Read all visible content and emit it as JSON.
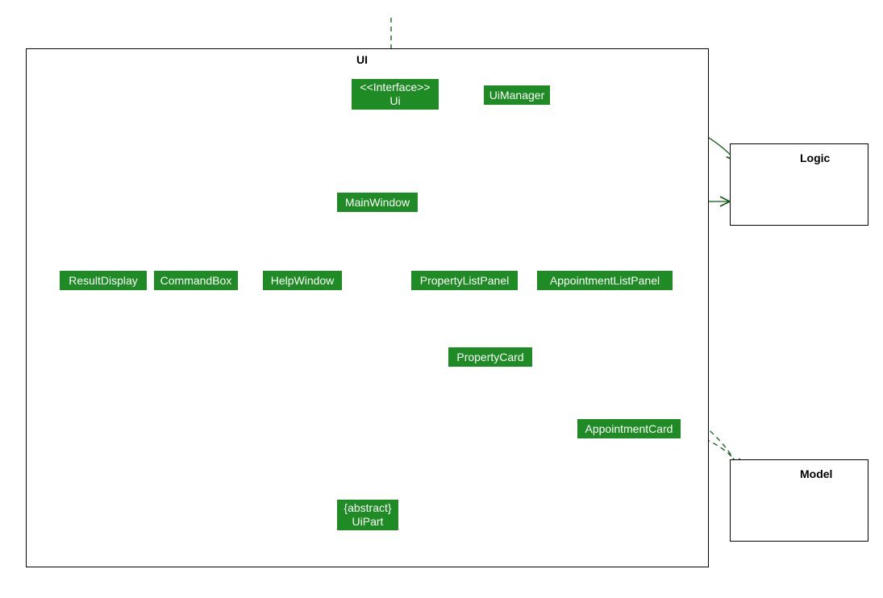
{
  "packages": {
    "ui_label": "UI",
    "logic_label": "Logic",
    "model_label": "Model"
  },
  "classes": {
    "ui_interface": {
      "stereotype": "<<Interface>>",
      "name": "Ui"
    },
    "ui_manager": "UiManager",
    "main_window": "MainWindow",
    "result_display": "ResultDisplay",
    "command_box": "CommandBox",
    "help_window": "HelpWindow",
    "property_list_panel": "PropertyListPanel",
    "appointment_list_panel": "AppointmentListPanel",
    "property_card": "PropertyCard",
    "appointment_card": "AppointmentCard",
    "ui_part": {
      "stereotype": "{abstract}",
      "name": "UiPart"
    }
  }
}
